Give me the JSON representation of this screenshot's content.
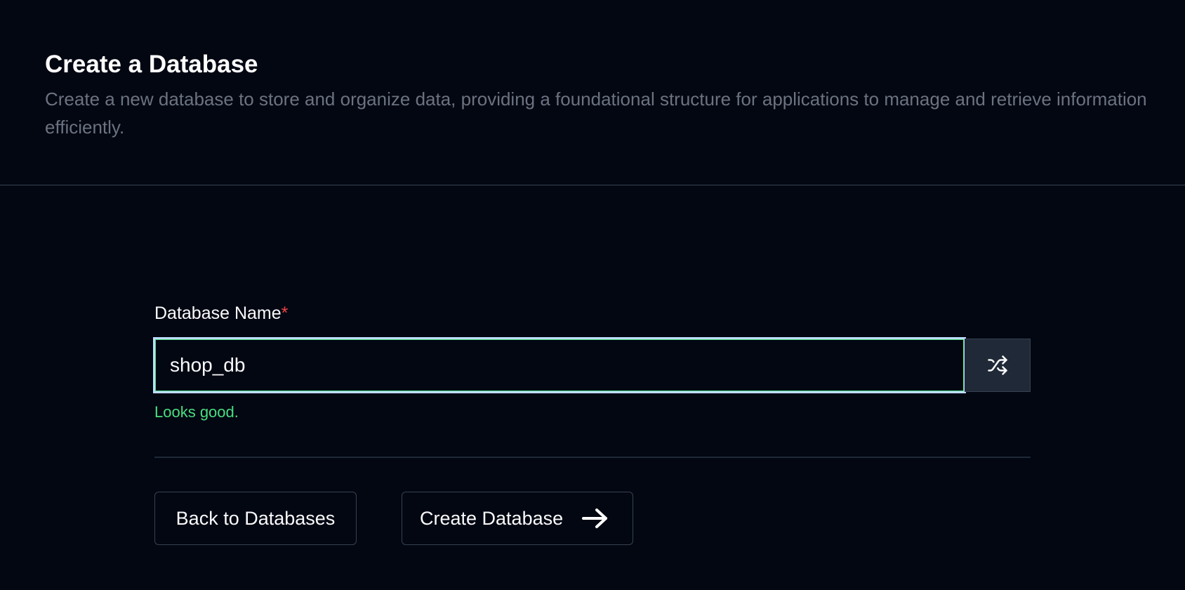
{
  "header": {
    "title": "Create a Database",
    "description": "Create a new database to store and organize data, providing a foundational structure for applications to manage and retrieve information efficiently."
  },
  "form": {
    "name_label": "Database Name",
    "required_mark": "*",
    "name_value": "shop_db",
    "validation_message": "Looks good.",
    "shuffle_icon": "shuffle-icon"
  },
  "actions": {
    "back_label": "Back to Databases",
    "create_label": "Create Database",
    "create_icon": "arrow-right-icon"
  },
  "colors": {
    "background": "#030712",
    "valid": "#4ade80",
    "required": "#ef4444",
    "muted_text": "#6b7280"
  }
}
